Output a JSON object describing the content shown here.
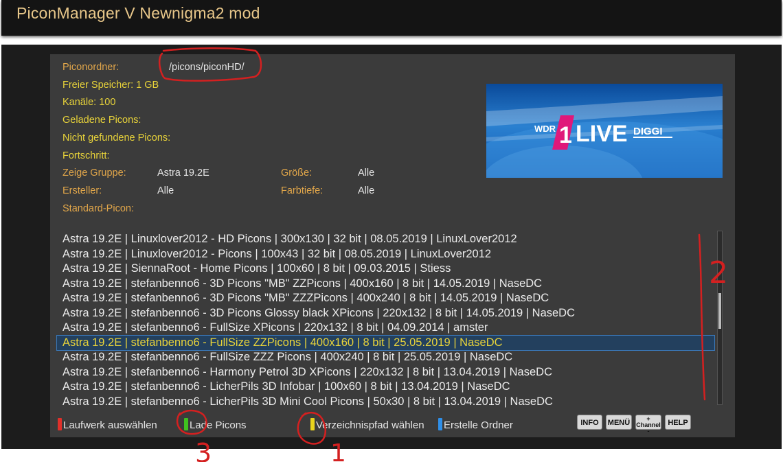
{
  "app_title": "PiconManager   V Newnigma2 mod",
  "info": {
    "picon_folder_label": "Piconordner:",
    "picon_folder_value": "/picons/piconHD/",
    "free_space": "Freier Speicher: 1 GB",
    "channels": "Kanäle: 100",
    "loaded_picons": "Geladene Picons:",
    "not_found_picons": "Nicht gefundene Picons:",
    "progress": "Fortschritt:",
    "show_group_label": "Zeige Gruppe:",
    "show_group_value": "Astra 19.2E",
    "size_label": "Größe:",
    "size_value": "Alle",
    "creator_label": "Ersteller:",
    "creator_value": "Alle",
    "color_depth_label": "Farbtiefe:",
    "color_depth_value": "Alle",
    "default_picon": "Standard-Picon:"
  },
  "preview_logo": {
    "wdr": "WDR",
    "one": "1",
    "live": "LIVE",
    "diggi": "DIGGI"
  },
  "picon_list": [
    "Astra 19.2E | Linuxlover2012 - HD Picons | 300x130 | 32 bit | 08.05.2019 | LinuxLover2012",
    "Astra 19.2E | Linuxlover2012 - Picons | 100x43 | 32 bit | 08.05.2019 | LinuxLover2012",
    "Astra 19.2E | SiennaRoot - Home Picons | 100x60 | 8 bit | 09.03.2015 | Stiess",
    "Astra 19.2E | stefanbenno6 - 3D Picons \"MB\" ZZPicons | 400x160 | 8 bit | 14.05.2019 | NaseDC",
    "Astra 19.2E | stefanbenno6 - 3D Picons \"MB\" ZZZPicons | 400x240 | 8 bit | 14.05.2019 | NaseDC",
    "Astra 19.2E | stefanbenno6 - 3D Picons Glossy black XPicons | 220x132 | 8 bit | 14.05.2019 | NaseDC",
    "Astra 19.2E | stefanbenno6 - FullSize XPicons | 220x132 | 8 bit | 04.09.2014 | amster",
    "Astra 19.2E | stefanbenno6 - FullSize ZZPicons | 400x160 | 8 bit | 25.05.2019 | NaseDC",
    "Astra 19.2E | stefanbenno6 - FullSize ZZZ Picons | 400x240 | 8 bit | 25.05.2019 | NaseDC",
    "Astra 19.2E | stefanbenno6 - Harmony Petrol 3D XPicons | 220x132 | 8 bit | 13.04.2019 | NaseDC",
    "Astra 19.2E | stefanbenno6 - LicherPils 3D Infobar | 100x60 | 8 bit | 13.04.2019 | NaseDC",
    "Astra 19.2E | stefanbenno6 - LicherPils 3D Mini Cool Picons | 50x30 | 8 bit | 13.04.2019 | NaseDC"
  ],
  "selected_index": 7,
  "scroll_position_fraction": 0.45,
  "color_buttons": {
    "red": "Laufwerk auswählen",
    "green": "Lade Picons",
    "yellow": "Verzeichnispfad wählen",
    "blue": "Erstelle Ordner"
  },
  "key_colors": {
    "red": "#e0302a",
    "green": "#3fc21f",
    "yellow": "#e8d21c",
    "blue": "#2f8fe8"
  },
  "rc_buttons": {
    "info": "INFO",
    "menu": "MENÜ",
    "channel": "Channel",
    "channel_plus": "+",
    "channel_minus": "-",
    "help": "HELP"
  },
  "annotations": {
    "one": "1",
    "two": "2",
    "three": "3"
  },
  "accent_color": "#e8d33a"
}
